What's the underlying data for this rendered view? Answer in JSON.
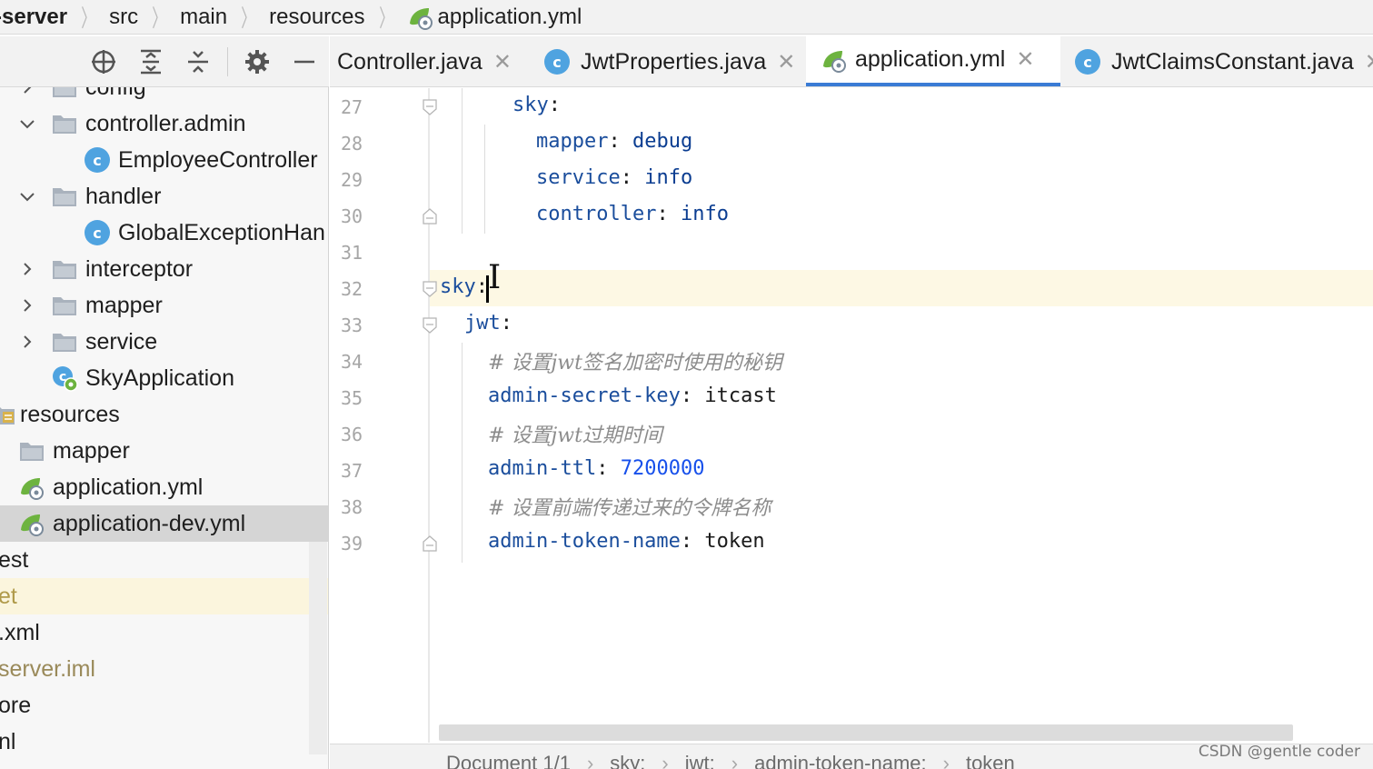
{
  "breadcrumb": [
    "-server",
    "src",
    "main",
    "resources",
    "application.yml"
  ],
  "toolbar": {
    "icons": [
      "crosshair-icon",
      "expand-all-icon",
      "collapse-all-icon",
      "settings-icon",
      "minimize-icon"
    ]
  },
  "tree": {
    "items": [
      {
        "label": "config",
        "icon": "folder",
        "expanded": false
      },
      {
        "label": "controller.admin",
        "icon": "folder",
        "expanded": true
      },
      {
        "label": "EmployeeController",
        "icon": "class"
      },
      {
        "label": "handler",
        "icon": "folder",
        "expanded": true
      },
      {
        "label": "GlobalExceptionHan",
        "icon": "class"
      },
      {
        "label": "interceptor",
        "icon": "folder",
        "expanded": false
      },
      {
        "label": "mapper",
        "icon": "folder",
        "expanded": false
      },
      {
        "label": "service",
        "icon": "folder",
        "expanded": false
      },
      {
        "label": "SkyApplication",
        "icon": "spring-class"
      },
      {
        "label": "resources",
        "icon": "resources-folder"
      },
      {
        "label": "mapper",
        "icon": "folder"
      },
      {
        "label": "application.yml",
        "icon": "spring-yml"
      },
      {
        "label": "application-dev.yml",
        "icon": "spring-yml"
      },
      {
        "label": "est"
      },
      {
        "label": "et"
      },
      {
        "label": ".xml"
      },
      {
        "label": "server.iml"
      },
      {
        "label": "ore"
      },
      {
        "label": "nl"
      }
    ]
  },
  "tabs": [
    {
      "label": "Controller.java",
      "icon": "none"
    },
    {
      "label": "JwtProperties.java",
      "icon": "class"
    },
    {
      "label": "application.yml",
      "icon": "spring-yml",
      "active": true
    },
    {
      "label": "JwtClaimsConstant.java",
      "icon": "class"
    }
  ],
  "editor": {
    "lines": [
      {
        "no": "27",
        "key": "sky",
        "value": ""
      },
      {
        "no": "28",
        "key": "mapper",
        "value": "debug"
      },
      {
        "no": "29",
        "key": "service",
        "value": "info"
      },
      {
        "no": "30",
        "key": "controller",
        "value": "info"
      },
      {
        "no": "31",
        "key": "",
        "value": ""
      },
      {
        "no": "32",
        "key": "sky",
        "value": ""
      },
      {
        "no": "33",
        "key": "jwt",
        "value": ""
      },
      {
        "no": "34",
        "comment": "# 设置jwt签名加密时使用的秘钥"
      },
      {
        "no": "35",
        "key": "admin-secret-key",
        "value": "itcast"
      },
      {
        "no": "36",
        "comment": "# 设置jwt过期时间"
      },
      {
        "no": "37",
        "key": "admin-ttl",
        "value": "7200000"
      },
      {
        "no": "38",
        "comment": "# 设置前端传递过来的令牌名称"
      },
      {
        "no": "39",
        "key": "admin-token-name",
        "value": "token"
      }
    ]
  },
  "status": {
    "path": [
      "Document 1/1",
      "sky:",
      "jwt:",
      "admin-token-name:",
      "token"
    ]
  },
  "watermark": "CSDN @gentle coder",
  "colors": {
    "accent": "#3a7bd5",
    "yaml_key": "#1a4d9c",
    "comment": "#8c8c8c",
    "number": "#1750eb",
    "class_badge": "#4fa3e0",
    "spring_green": "#6db33f"
  }
}
